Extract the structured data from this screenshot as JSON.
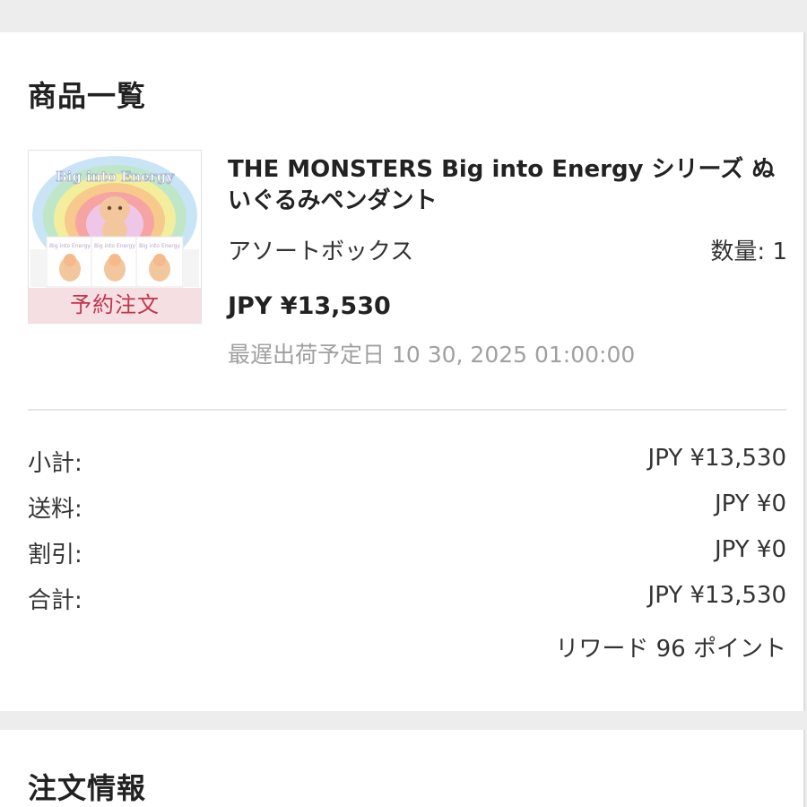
{
  "products_section": {
    "title": "商品一覧",
    "item": {
      "name": "THE MONSTERS Big into Energy シリーズ ぬいぐるみペンダント",
      "variant": "アソートボックス",
      "quantity": "数量: 1",
      "price": "JPY ¥13,530",
      "latest_ship_date": "最遅出荷予定日 10 30, 2025 01:00:00",
      "thumbnail": {
        "badge": "予約注文",
        "logo_text": "Big into Energy",
        "box_text": "Big into Energy"
      }
    },
    "summary": [
      {
        "label": "小計:",
        "value": "JPY ¥13,530"
      },
      {
        "label": "送料:",
        "value": "JPY ¥0"
      },
      {
        "label": "割引:",
        "value": "JPY ¥0"
      },
      {
        "label": "合計:",
        "value": "JPY ¥13,530"
      }
    ],
    "reward": "リワード 96 ポイント"
  },
  "order_section": {
    "title": "注文情報"
  },
  "colors": {
    "background": "#ededed",
    "card": "#ffffff",
    "badge_bg": "#f6dfe3",
    "badge_text": "#c0364d",
    "muted_text": "#a0a0a0"
  }
}
